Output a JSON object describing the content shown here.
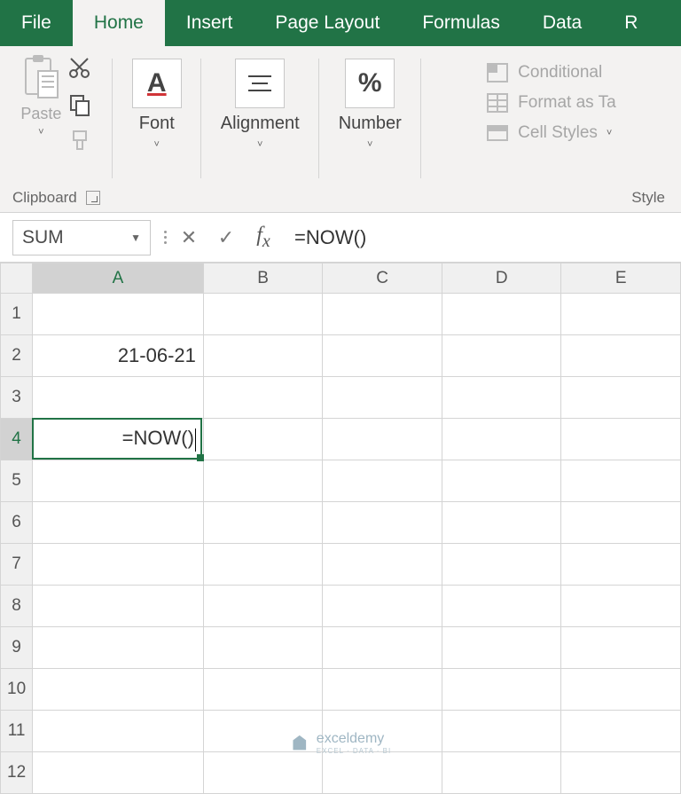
{
  "tabs": {
    "file": "File",
    "home": "Home",
    "insert": "Insert",
    "pageLayout": "Page Layout",
    "formulas": "Formulas",
    "data": "Data",
    "review_partial": "R"
  },
  "ribbon": {
    "clipboard": {
      "paste": "Paste",
      "label": "Clipboard"
    },
    "font": {
      "glyph": "A",
      "label": "Font"
    },
    "alignment": {
      "glyph": "≡",
      "label": "Alignment"
    },
    "number": {
      "glyph": "%",
      "label": "Number"
    },
    "styles": {
      "conditional": "Conditional",
      "formatTable": "Format as Ta",
      "cellStyles": "Cell Styles",
      "label": "Style"
    }
  },
  "nameBox": "SUM",
  "formulaBar": "=NOW()",
  "columns": [
    "A",
    "B",
    "C",
    "D",
    "E"
  ],
  "rows": [
    "1",
    "2",
    "3",
    "4",
    "5",
    "6",
    "7",
    "8",
    "9",
    "10",
    "11",
    "12"
  ],
  "cells": {
    "A2": "21-06-21",
    "A4": "=NOW()"
  },
  "activeCell": "A4",
  "activeCol": "A",
  "activeRow": "4",
  "chevron": "˅",
  "watermark": {
    "name": "exceldemy",
    "sub": "EXCEL · DATA · BI"
  }
}
